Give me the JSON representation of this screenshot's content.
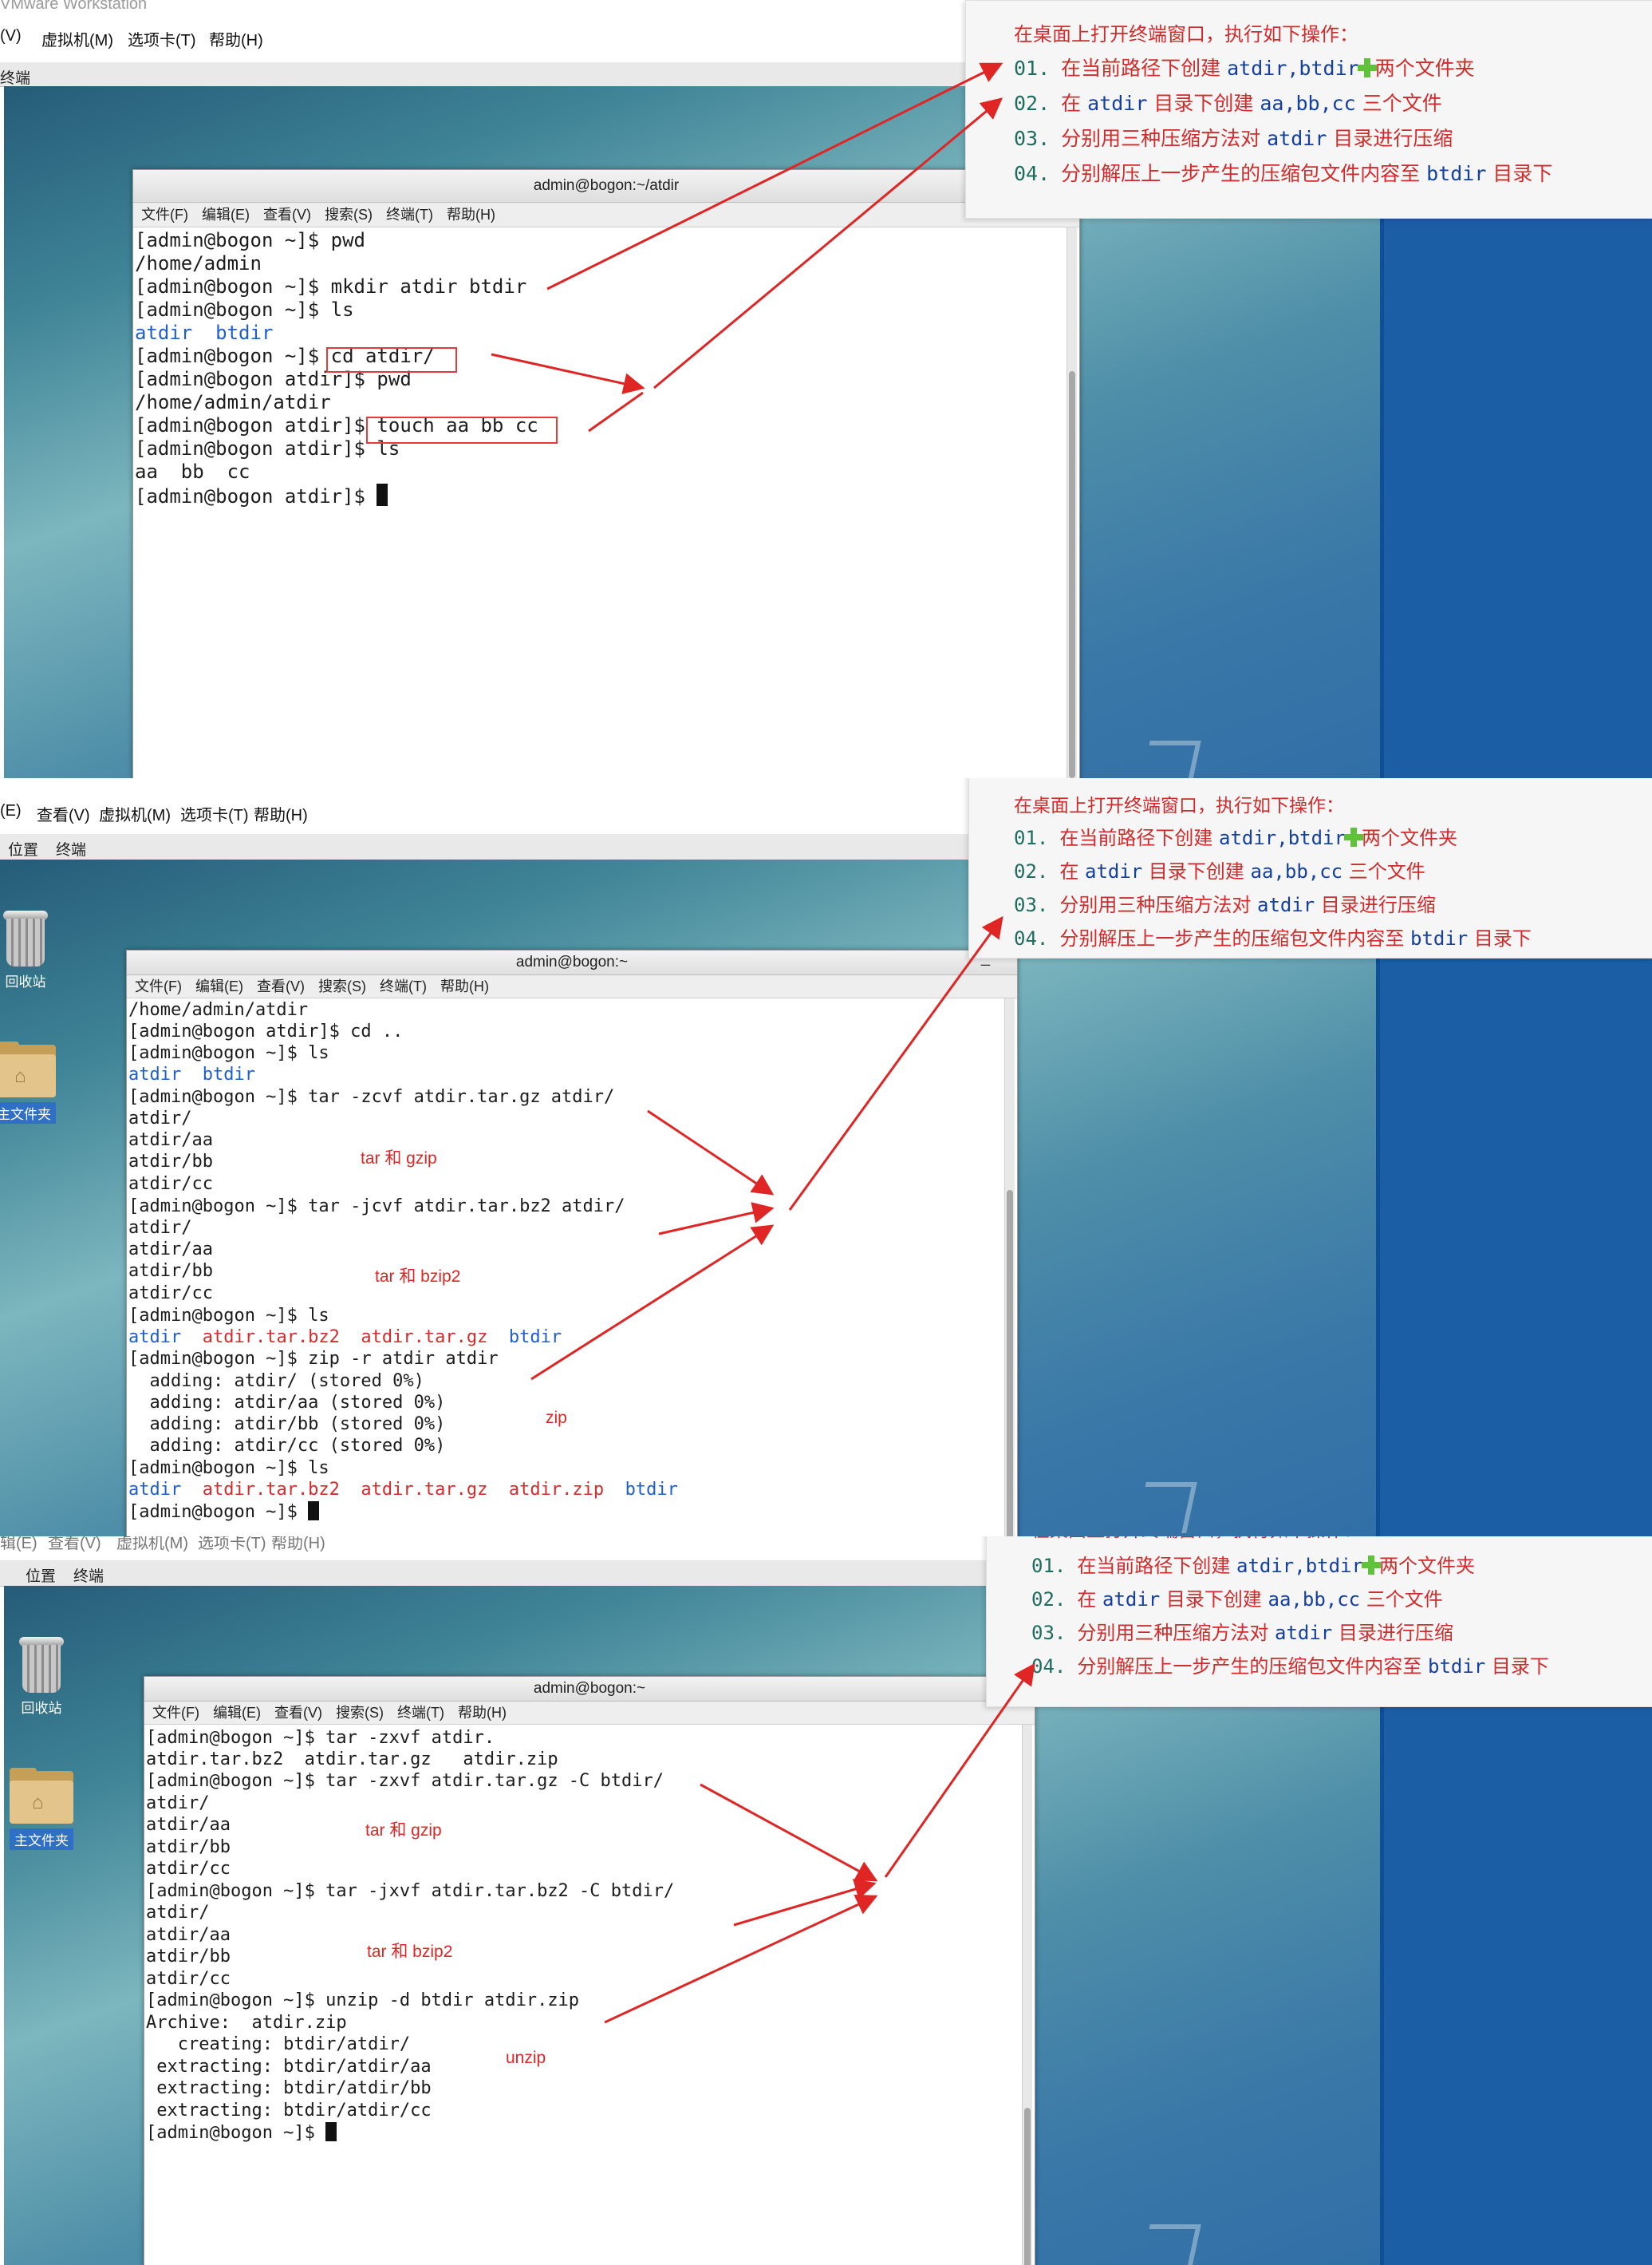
{
  "vmware_title": "VMware Workstation",
  "colors": {
    "accent_red": "#e02525",
    "link_blue": "#1e5fd0",
    "step_number": "#1f6c5e",
    "keyword_blue": "#1540a0",
    "plus_green": "#5fc23a"
  },
  "instructions": {
    "heading": "在桌面上打开终端窗口，执行如下操作：",
    "steps": [
      {
        "num": "01.",
        "pre": "在当前路径下创建",
        "kw": "atdir,btdir",
        "icon": "plus-icon",
        "post": "两个文件夹"
      },
      {
        "num": "02.",
        "pre": "在",
        "kw": "atdir",
        "mid": "目录下创建",
        "kw2": "aa,bb,cc",
        "post": "三个文件"
      },
      {
        "num": "03.",
        "pre": "分别用三种压缩方法对",
        "kw": "atdir",
        "post": "目录进行压缩"
      },
      {
        "num": "04.",
        "pre": "分别解压上一步产生的压缩包文件内容至",
        "kw": "btdir",
        "post": "目录下"
      }
    ]
  },
  "panel1": {
    "menubar": [
      "(V)",
      "虚拟机(M)",
      "选项卡(T)",
      "帮助(H)"
    ],
    "tab": "终端",
    "terminal": {
      "title": "admin@bogon:~/atdir",
      "menu": [
        "文件(F)",
        "编辑(E)",
        "查看(V)",
        "搜索(S)",
        "终端(T)",
        "帮助(H)"
      ],
      "lines": [
        "[admin@bogon ~]$ pwd",
        "/home/admin",
        "[admin@bogon ~]$ mkdir atdir btdir",
        "[admin@bogon ~]$ ls",
        "atdir  btdir",
        "[admin@bogon ~]$ cd atdir/",
        "[admin@bogon atdir]$ pwd",
        "/home/admin/atdir",
        "[admin@bogon atdir]$ touch aa bb cc",
        "[admin@bogon atdir]$ ls",
        "aa  bb  cc",
        "[admin@bogon atdir]$ "
      ]
    }
  },
  "panel2": {
    "menubar": [
      "(E)",
      "查看(V)",
      "虚拟机(M)",
      "选项卡(T)",
      "帮助(H)"
    ],
    "tabs": [
      "位置",
      "终端"
    ],
    "desktop_icons": {
      "trash": "回收站",
      "home": "主文件夹"
    },
    "terminal": {
      "title": "admin@bogon:~",
      "minimize": "_",
      "menu": [
        "文件(F)",
        "编辑(E)",
        "查看(V)",
        "搜索(S)",
        "终端(T)",
        "帮助(H)"
      ],
      "lines": [
        "/home/admin/atdir",
        "[admin@bogon atdir]$ cd ..",
        "[admin@bogon ~]$ ls",
        "atdir  btdir",
        "[admin@bogon ~]$ tar -zcvf atdir.tar.gz atdir/",
        "atdir/",
        "atdir/aa",
        "atdir/bb",
        "atdir/cc",
        "[admin@bogon ~]$ tar -jcvf atdir.tar.bz2 atdir/",
        "atdir/",
        "atdir/aa",
        "atdir/bb",
        "atdir/cc",
        "[admin@bogon ~]$ ls",
        "atdir  atdir.tar.bz2  atdir.tar.gz  btdir",
        "[admin@bogon ~]$ zip -r atdir atdir",
        "  adding: atdir/ (stored 0%)",
        "  adding: atdir/aa (stored 0%)",
        "  adding: atdir/bb (stored 0%)",
        "  adding: atdir/cc (stored 0%)",
        "[admin@bogon ~]$ ls",
        "atdir  atdir.tar.bz2  atdir.tar.gz  atdir.zip  btdir",
        "[admin@bogon ~]$ "
      ]
    },
    "notes": [
      "tar 和 gzip",
      "tar 和 bzip2",
      "zip"
    ]
  },
  "panel3": {
    "menubar": [
      "辑(E)",
      "查看(V)",
      "虚拟机(M)",
      "选项卡(T)",
      "帮助(H)"
    ],
    "tabs": [
      "位置",
      "终端"
    ],
    "desktop_icons": {
      "trash": "回收站",
      "home": "主文件夹"
    },
    "terminal": {
      "title": "admin@bogon:~",
      "minimize": "_",
      "menu": [
        "文件(F)",
        "编辑(E)",
        "查看(V)",
        "搜索(S)",
        "终端(T)",
        "帮助(H)"
      ],
      "lines": [
        "[admin@bogon ~]$ tar -zxvf atdir.",
        "atdir.tar.bz2  atdir.tar.gz   atdir.zip",
        "[admin@bogon ~]$ tar -zxvf atdir.tar.gz -C btdir/",
        "atdir/",
        "atdir/aa",
        "atdir/bb",
        "atdir/cc",
        "[admin@bogon ~]$ tar -jxvf atdir.tar.bz2 -C btdir/",
        "atdir/",
        "atdir/aa",
        "atdir/bb",
        "atdir/cc",
        "[admin@bogon ~]$ unzip -d btdir atdir.zip",
        "Archive:  atdir.zip",
        "   creating: btdir/atdir/",
        " extracting: btdir/atdir/aa",
        " extracting: btdir/atdir/bb",
        " extracting: btdir/atdir/cc",
        "[admin@bogon ~]$ "
      ]
    },
    "notes": [
      "tar 和 gzip",
      "tar 和 bzip2",
      "unzip"
    ]
  }
}
